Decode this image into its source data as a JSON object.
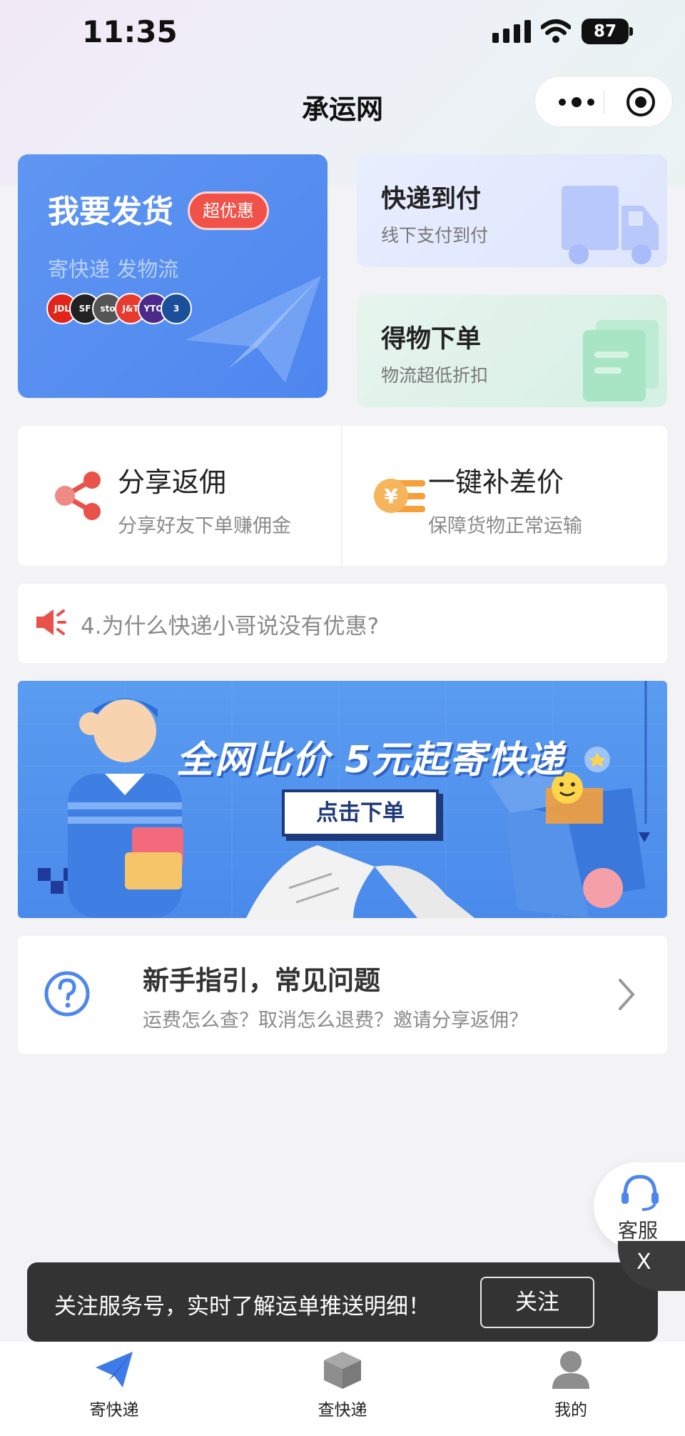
{
  "status_bar": {
    "time": "11:35",
    "battery": "87"
  },
  "nav": {
    "title": "承运网"
  },
  "send_card": {
    "title": "我要发货",
    "badge": "超优惠",
    "subtitle": "寄快递 发物流",
    "carriers": [
      {
        "name": "JDL",
        "color": "#e1251b"
      },
      {
        "name": "SF",
        "color": "#222222"
      },
      {
        "name": "sto",
        "color": "#555555"
      },
      {
        "name": "J&T",
        "color": "#e83a2f"
      },
      {
        "name": "YTO",
        "color": "#4b2a8c"
      },
      {
        "name": "3",
        "color": "#1c4f9a"
      }
    ]
  },
  "cod_card": {
    "title": "快递到付",
    "subtitle": "线下支付到付"
  },
  "dewu_card": {
    "title": "得物下单",
    "subtitle": "物流超低折扣"
  },
  "share": {
    "title": "分享返佣",
    "subtitle": "分享好友下单赚佣金"
  },
  "price_diff": {
    "title": "一键补差价",
    "subtitle": "保障货物正常运输"
  },
  "notice": {
    "text": "4.为什么快递小哥说没有优惠?"
  },
  "banner": {
    "headline": "全网比价  5元起寄快递",
    "button": "点击下单"
  },
  "guide": {
    "title": "新手指引，常见问题",
    "subtitle": "运费怎么查？取消怎么退费？邀请分享返佣？"
  },
  "customer_service": {
    "label": "客服"
  },
  "follow_bar": {
    "text": "关注服务号，实时了解运单推送明细！",
    "button": "关注",
    "close": "X"
  },
  "tabs": [
    {
      "label": "寄快递",
      "icon": "paper-plane-icon",
      "active": true
    },
    {
      "label": "查快递",
      "icon": "package-icon",
      "active": false
    },
    {
      "label": "我的",
      "icon": "user-icon",
      "active": false
    }
  ],
  "colors": {
    "accent": "#4e86ef",
    "badge_red": "#f0524a",
    "share_red": "#e8524a",
    "coin_orange": "#f5a03b",
    "active_tab": "#3e7be8",
    "inactive_tab": "#8e8e8e"
  }
}
